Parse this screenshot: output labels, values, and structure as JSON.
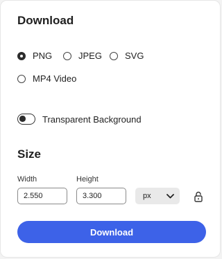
{
  "panel": {
    "title": "Download",
    "format_options": [
      {
        "label": "PNG",
        "selected": true
      },
      {
        "label": "JPEG",
        "selected": false
      },
      {
        "label": "SVG",
        "selected": false
      },
      {
        "label": "MP4 Video",
        "selected": false
      }
    ],
    "transparent_background": {
      "label": "Transparent Background",
      "on": false
    },
    "size": {
      "title": "Size",
      "width_label": "Width",
      "width_value": "2.550",
      "height_label": "Height",
      "height_value": "3.300",
      "unit_value": "px"
    },
    "download_button": "Download"
  },
  "colors": {
    "accent": "#3d62e8",
    "text": "#1f1f1f",
    "panel_bg": "#ffffff",
    "unit_bg": "#e9e9e9"
  },
  "icons": {
    "unit_dropdown": "chevron-down-icon",
    "aspect_lock": "unlocked-padlock-icon"
  }
}
